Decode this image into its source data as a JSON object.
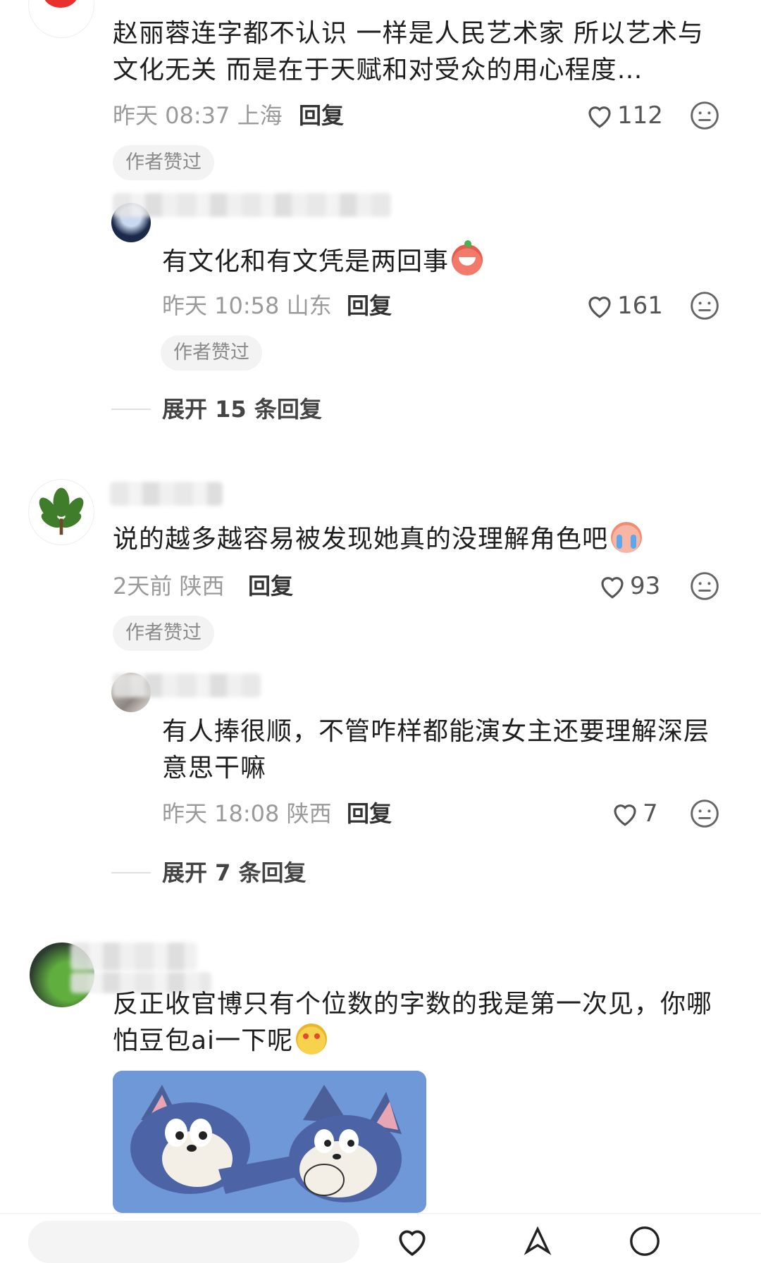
{
  "comments": [
    {
      "text": "赵丽蓉连字都不认识 一样是人民艺术家 所以艺术与文化无关 而是在于天赋和对受众的用心程度…",
      "time": "昨天 08:37 上海",
      "reply_label": "回复",
      "likes": "112",
      "badge": "作者赞过",
      "replies": [
        {
          "text": "有文化和有文凭是两回事",
          "time": "昨天 10:58 山东",
          "reply_label": "回复",
          "likes": "161",
          "badge": "作者赞过"
        }
      ],
      "expand_label": "展开 15 条回复"
    },
    {
      "text": "说的越多越容易被发现她真的没理解角色吧",
      "time": "2天前 陕西",
      "reply_label": "回复",
      "likes": "93",
      "badge": "作者赞过",
      "replies": [
        {
          "text": "有人捧很顺，不管咋样都能演女主还要理解深层意思干嘛",
          "time": "昨天 18:08 陕西",
          "reply_label": "回复",
          "likes": "7"
        }
      ],
      "expand_label": "展开 7 条回复"
    },
    {
      "text": "反正收官博只有个位数的字数的我是第一次见，你哪怕豆包ai一下呢"
    }
  ],
  "colors": {
    "badge_bg": "#f3f3f3",
    "meta_text": "#9a9a9a",
    "heart_stroke": "#555555",
    "tom_blue": "#4a6fb5",
    "tom_bg": "#6b94d6"
  }
}
